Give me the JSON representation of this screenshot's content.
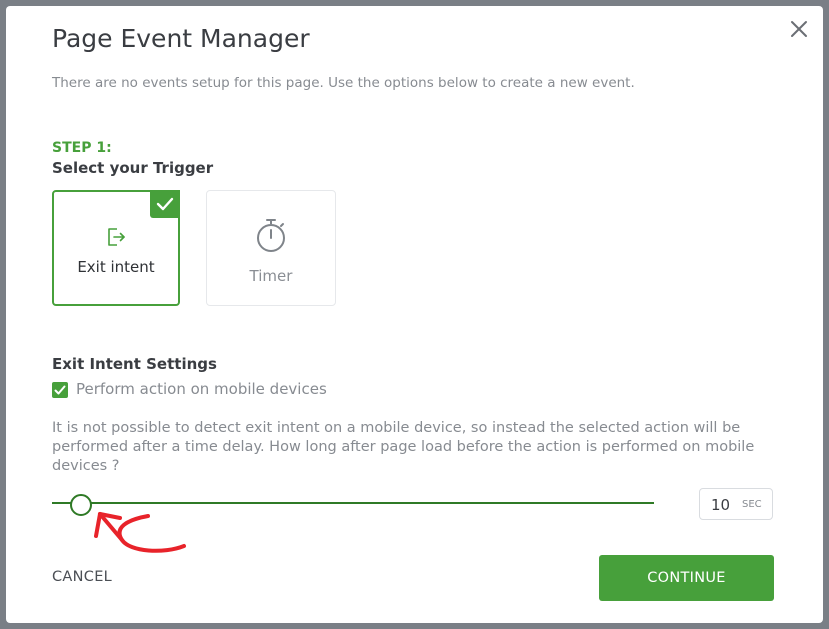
{
  "modal": {
    "title": "Page Event Manager",
    "intro": "There are no events setup for this page. Use the options below to create a new event."
  },
  "step": {
    "label": "STEP 1:",
    "title": "Select your Trigger"
  },
  "triggers": [
    {
      "label": "Exit intent",
      "icon": "exit-icon",
      "selected": true
    },
    {
      "label": "Timer",
      "icon": "stopwatch-icon",
      "selected": false
    }
  ],
  "settings": {
    "title": "Exit Intent Settings",
    "mobile_label": "Perform action on mobile devices",
    "mobile_checked": true,
    "description": "It is not possible to detect exit intent on a mobile device, so instead the selected action will be performed after a time delay. How long after page load before the action is performed on mobile devices ?"
  },
  "delay": {
    "value": "10",
    "unit": "SEC",
    "slider_fraction": 0.045
  },
  "actions": {
    "cancel": "CANCEL",
    "continue": "CONTINUE"
  },
  "colors": {
    "accent": "#47a03b",
    "slider": "#2f7a26",
    "annotation": "#e8232a"
  }
}
